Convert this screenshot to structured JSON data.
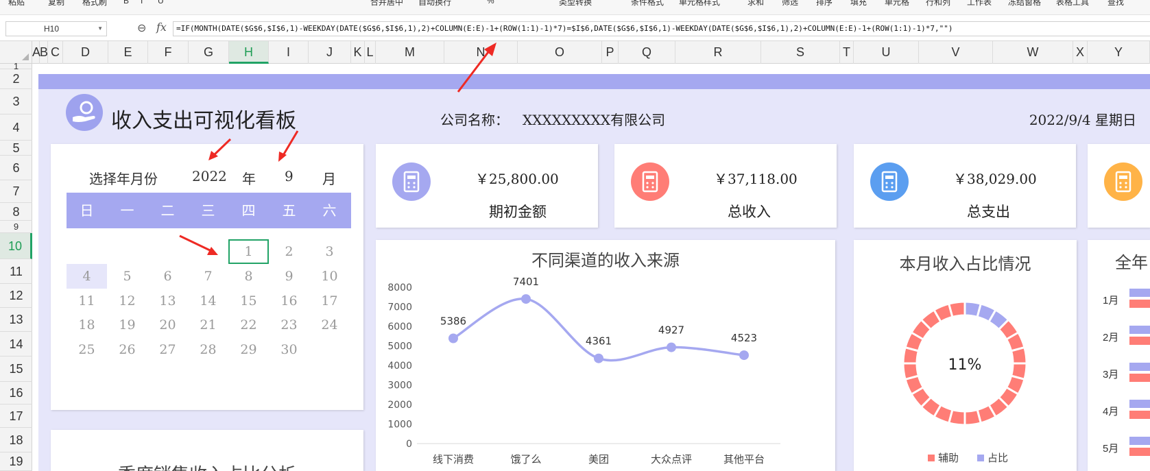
{
  "ribbon": {
    "items": [
      "粘贴",
      "复制",
      "格式刷",
      "B",
      "I",
      "U",
      "合并居中",
      "自动换行",
      "%",
      "类型转换",
      "条件格式",
      "单元格样式",
      "求和",
      "筛选",
      "排序",
      "填充",
      "单元格",
      "行和列",
      "工作表",
      "冻结窗格",
      "表格工具",
      "查找"
    ]
  },
  "formula_bar": {
    "name_box": "H10",
    "fx": "fx",
    "formula": "=IF(MONTH(DATE($G$6,$I$6,1)-WEEKDAY(DATE($G$6,$I$6,1),2)+COLUMN(E:E)-1+(ROW(1:1)-1)*7)=$I$6,DATE($G$6,$I$6,1)-WEEKDAY(DATE($G$6,$I$6,1),2)+COLUMN(E:E)-1+(ROW(1:1)-1)*7,\"\")"
  },
  "columns": [
    "A",
    "B",
    "C",
    "D",
    "E",
    "F",
    "G",
    "H",
    "I",
    "J",
    "K",
    "L",
    "M",
    "N",
    "O",
    "P",
    "Q",
    "R",
    "S",
    "T",
    "U",
    "V",
    "W",
    "X",
    "Y"
  ],
  "rows": [
    "1",
    "2",
    "3",
    "4",
    "5",
    "6",
    "7",
    "8",
    "9",
    "10",
    "11",
    "12",
    "13",
    "14",
    "15",
    "16",
    "17",
    "18",
    "19"
  ],
  "selected_column": "H",
  "selected_row": "10",
  "dashboard": {
    "title": "收入支出可视化看板",
    "company_label": "公司名称：",
    "company_name": "XXXXXXXXX有限公司",
    "date": "2022/9/4 星期日",
    "colors": {
      "accent": "#a5a8f0",
      "background": "#e6e6fa",
      "coral": "#ff7d76",
      "blue": "#5b9ef0",
      "orange": "#ffb347"
    }
  },
  "calendar": {
    "select_label": "选择年月份",
    "year": "2022",
    "year_unit": "年",
    "month": "9",
    "month_unit": "月",
    "weekdays": [
      "日",
      "一",
      "二",
      "三",
      "四",
      "五",
      "六"
    ],
    "weeks": [
      [
        "",
        "",
        "",
        "",
        "1",
        "2",
        "3"
      ],
      [
        "4",
        "5",
        "6",
        "7",
        "8",
        "9",
        "10"
      ],
      [
        "11",
        "12",
        "13",
        "14",
        "15",
        "16",
        "17"
      ],
      [
        "18",
        "19",
        "20",
        "21",
        "22",
        "23",
        "24"
      ],
      [
        "25",
        "26",
        "27",
        "28",
        "29",
        "30",
        ""
      ]
    ]
  },
  "kpis": [
    {
      "amount": "￥25,800.00",
      "label": "期初金额",
      "icon": "calculator-icon",
      "color": "#a5a8f0"
    },
    {
      "amount": "￥37,118.00",
      "label": "总收入",
      "icon": "bar-chart-icon",
      "color": "#ff7d76"
    },
    {
      "amount": "￥38,029.00",
      "label": "总支出",
      "icon": "atm-icon",
      "color": "#5b9ef0"
    },
    {
      "amount": "",
      "label": "",
      "icon": "wallet-icon",
      "color": "#ffb347"
    }
  ],
  "income_source": {
    "title": "不同渠道的收入来源"
  },
  "month_share": {
    "title": "本月收入占比情况",
    "center_label": "11%",
    "legend": [
      "辅助",
      "占比"
    ]
  },
  "year_panel": {
    "title": "全年",
    "months": [
      "1月",
      "2月",
      "3月",
      "4月",
      "5月"
    ]
  },
  "quarter_panel": {
    "title": "季度销售收入占比分析"
  },
  "chart_data": [
    {
      "type": "line",
      "categories": [
        "线下消费",
        "饿了么",
        "美团",
        "大众点评",
        "其他平台"
      ],
      "values": [
        5386,
        7401,
        4361,
        4927,
        4523
      ],
      "ylim": [
        0,
        8000
      ],
      "yticks": [
        "0",
        "1000",
        "2000",
        "3000",
        "4000",
        "5000",
        "6000",
        "7000",
        "8000"
      ],
      "smooth": true,
      "color": "#a5a8f0"
    },
    {
      "type": "pie",
      "donut": true,
      "labels": [
        "占比",
        "辅助"
      ],
      "values": [
        11,
        89
      ],
      "colors": [
        "#a5a8f0",
        "#ff7d76"
      ]
    }
  ]
}
